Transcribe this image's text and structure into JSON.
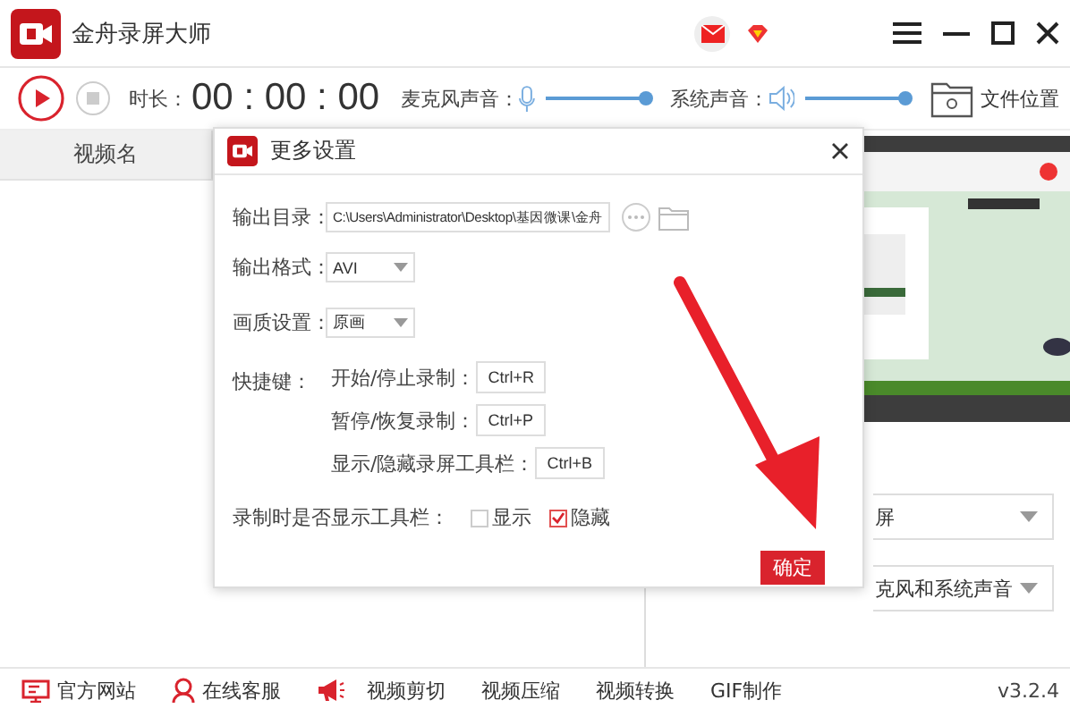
{
  "window": {
    "title": "金舟录屏大师"
  },
  "toolbar": {
    "duration_label": "时长：",
    "duration": "00 : 00 : 00",
    "sliders": [
      {
        "label": "麦克风声音：",
        "kind": "mic",
        "level": 1
      },
      {
        "label": "系统声音：",
        "kind": "speaker",
        "level": 1
      }
    ],
    "file_location": "文件位置"
  },
  "file_list": {
    "columns": [
      "视频名"
    ]
  },
  "dropdowns": [
    {
      "value": "屏"
    },
    {
      "value": "克风和系统声音"
    }
  ],
  "dialog": {
    "title": "更多设置",
    "output_dir": {
      "label": "输出目录：",
      "value": "C:\\Users\\Administrator\\Desktop\\基因微课\\金舟"
    },
    "output_format": {
      "label": "输出格式：",
      "value": "AVI"
    },
    "quality": {
      "label": "画质设置：",
      "value": "原画"
    },
    "hotkeys": {
      "label": "快捷键：",
      "items": [
        {
          "label": "开始/停止录制：",
          "key": "Ctrl+R"
        },
        {
          "label": "暂停/恢复录制：",
          "key": "Ctrl+P"
        },
        {
          "label": "显示/隐藏录屏工具栏：",
          "key": "Ctrl+B"
        }
      ]
    },
    "toolbar_visibility": {
      "label": "录制时是否显示工具栏：",
      "options": [
        {
          "label": "显示",
          "checked": false
        },
        {
          "label": "隐藏",
          "checked": true
        }
      ]
    },
    "confirm": "确定"
  },
  "footer": {
    "links": [
      {
        "label": "官方网站",
        "kind": "monitor"
      },
      {
        "label": "在线客服",
        "kind": "person"
      },
      {
        "label": "视频剪切",
        "kind": "megaphone"
      },
      {
        "label": "视频压缩",
        "kind": "none"
      },
      {
        "label": "视频转换",
        "kind": "none"
      },
      {
        "label": "GIF制作",
        "kind": "none"
      }
    ],
    "version": "v3.2.4"
  }
}
